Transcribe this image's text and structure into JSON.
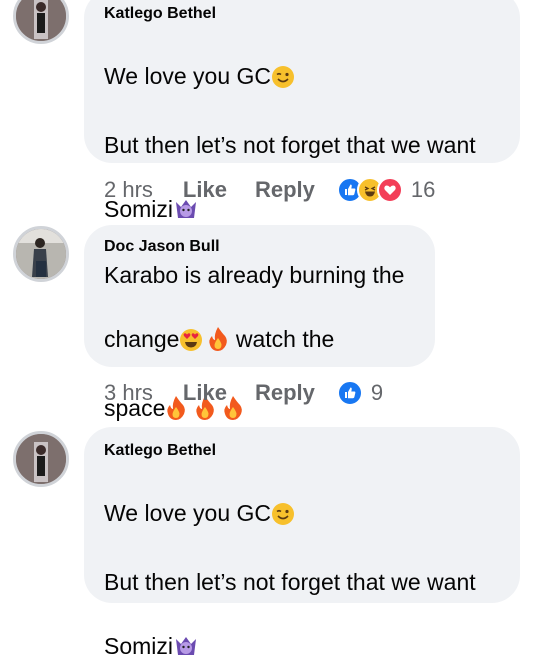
{
  "comments": [
    {
      "author": "Katlego Bethel",
      "line1": "We love you GC",
      "line2": "But then let’s not forget that we want",
      "line3": "Somizi",
      "time": "2 hrs",
      "like_label": "Like",
      "reply_label": "Reply",
      "reaction_count": "16",
      "reactions": [
        "like-icon",
        "laugh-icon",
        "love-icon"
      ],
      "emojis": [
        "winking-face-emoji",
        "ogre-emoji"
      ]
    },
    {
      "author": "Doc Jason Bull",
      "line1": "Karabo is already burning the",
      "line2a": "change",
      "line2b": "watch the",
      "line3": "space",
      "time": "3 hrs",
      "like_label": "Like",
      "reply_label": "Reply",
      "reaction_count": "9",
      "reactions": [
        "like-icon"
      ],
      "emojis": [
        "heart-eyes-emoji",
        "fire-emoji"
      ]
    },
    {
      "author": "Katlego Bethel",
      "line1": "We love you GC",
      "line2": "But then let’s not forget that we want",
      "line3": "Somizi",
      "emojis": [
        "winking-face-emoji",
        "ogre-emoji"
      ]
    }
  ],
  "colors": {
    "bubble": "#f0f2f5",
    "like_blue": "#1877f2",
    "love_red": "#f33e58",
    "meta_gray": "#65676b"
  }
}
